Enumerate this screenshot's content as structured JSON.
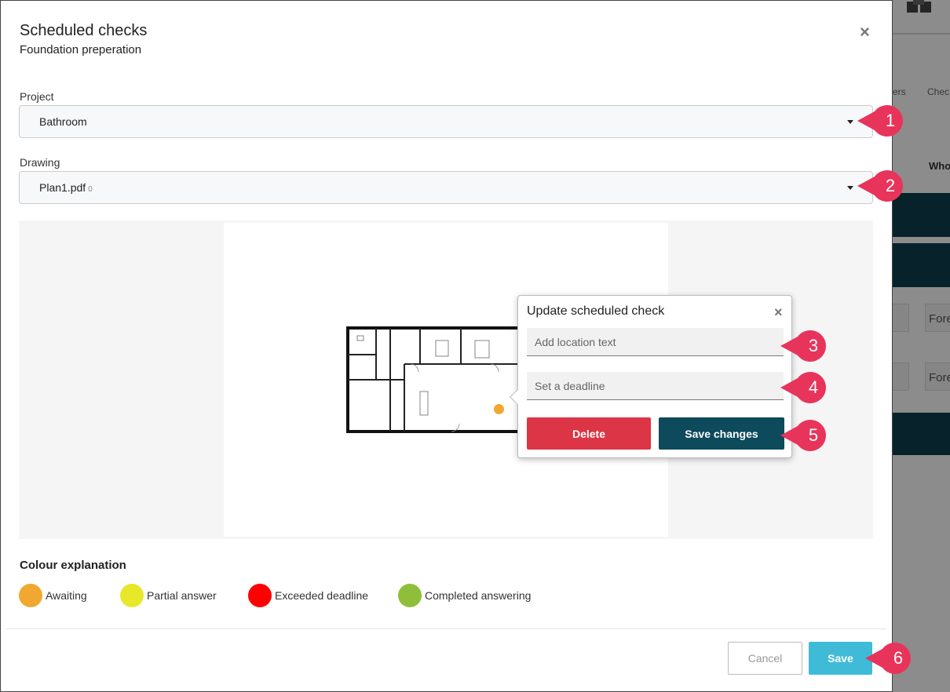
{
  "background": {
    "menu_items": [
      "ers",
      "Chec"
    ],
    "column_header": "Who",
    "row_inputs": [
      "Fore",
      "Fore"
    ]
  },
  "modal": {
    "title": "Scheduled checks",
    "subtitle": "Foundation preperation",
    "close_symbol": "×",
    "project": {
      "label": "Project",
      "value": "Bathroom"
    },
    "drawing": {
      "label": "Drawing",
      "value": "Plan1.pdf",
      "count": "0"
    },
    "popup": {
      "title": "Update scheduled check",
      "close_symbol": "×",
      "location_placeholder": "Add location text",
      "deadline_placeholder": "Set a deadline",
      "delete_label": "Delete",
      "save_changes_label": "Save changes"
    },
    "legend": {
      "title": "Colour explanation",
      "items": [
        {
          "label": "Awaiting",
          "color": "#f0a830"
        },
        {
          "label": "Partial answer",
          "color": "#e8e82a"
        },
        {
          "label": "Exceeded deadline",
          "color": "#ff0000"
        },
        {
          "label": "Completed answering",
          "color": "#8fbf3a"
        }
      ]
    },
    "footer": {
      "cancel_label": "Cancel",
      "save_label": "Save"
    }
  },
  "callouts": [
    "1",
    "2",
    "3",
    "4",
    "5",
    "6"
  ],
  "colors": {
    "marker": "#f0a830",
    "callout": "#e8345a",
    "primary_dark": "#0d4a5c",
    "danger": "#dc3545",
    "save": "#3fbbd8"
  }
}
